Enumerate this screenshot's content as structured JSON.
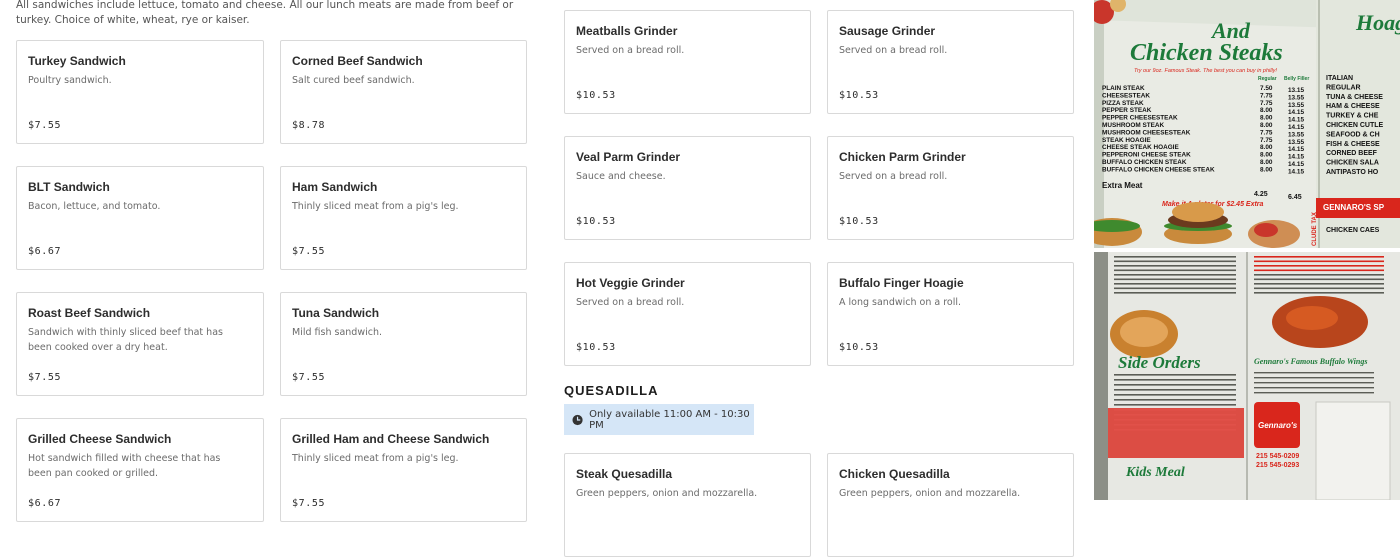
{
  "sandwiches": {
    "intro": "All sandwiches include lettuce, tomato and cheese. All our lunch meats are made from beef or turkey. Choice of white, wheat, rye or kaiser.",
    "items": [
      {
        "name": "Turkey Sandwich",
        "desc": "Poultry sandwich.",
        "price": "$7.55"
      },
      {
        "name": "Corned Beef Sandwich",
        "desc": "Salt cured beef sandwich.",
        "price": "$8.78"
      },
      {
        "name": "BLT Sandwich",
        "desc": "Bacon, lettuce, and tomato.",
        "price": "$6.67"
      },
      {
        "name": "Ham Sandwich",
        "desc": "Thinly sliced meat from a pig's leg.",
        "price": "$7.55"
      },
      {
        "name": "Roast Beef Sandwich",
        "desc": "Sandwich with thinly sliced beef that has been cooked over a dry heat.",
        "price": "$7.55"
      },
      {
        "name": "Tuna Sandwich",
        "desc": "Mild fish sandwich.",
        "price": "$7.55"
      },
      {
        "name": "Grilled Cheese Sandwich",
        "desc": "Hot sandwich filled with cheese that has been pan cooked or grilled.",
        "price": "$6.67"
      },
      {
        "name": "Grilled Ham and Cheese Sandwich",
        "desc": "Thinly sliced meat from a pig's leg.",
        "price": "$7.55"
      }
    ]
  },
  "grinders": {
    "items": [
      {
        "name": "Meatballs Grinder",
        "desc": "Served on a bread roll.",
        "price": "$10.53"
      },
      {
        "name": "Sausage Grinder",
        "desc": "Served on a bread roll.",
        "price": "$10.53"
      },
      {
        "name": "Veal Parm Grinder",
        "desc": "Sauce and cheese.",
        "price": "$10.53"
      },
      {
        "name": "Chicken Parm Grinder",
        "desc": "Served on a bread roll.",
        "price": "$10.53"
      },
      {
        "name": "Hot Veggie Grinder",
        "desc": "Served on a bread roll.",
        "price": "$10.53"
      },
      {
        "name": "Buffalo Finger Hoagie",
        "desc": "A long sandwich on a roll.",
        "price": "$10.53"
      }
    ]
  },
  "quesadilla": {
    "title": "QUESADILLA",
    "availability": "Only available 11:00 AM - 10:30 PM",
    "items": [
      {
        "name": "Steak Quesadilla",
        "desc": "Green peppers, onion and mozzarella."
      },
      {
        "name": "Chicken Quesadilla",
        "desc": "Green peppers, onion and mozzarella."
      }
    ]
  },
  "menu_photos": {
    "top": {
      "headline_1": "Hoag",
      "headline_2": "And",
      "headline_3": "Chicken Steaks",
      "slogan": "Try our 9oz. Famous Steak. The best you can buy in philly!",
      "col_regular": "Regular",
      "col_belly": "Belly Filler",
      "rows": [
        {
          "name": "PLAIN STEAK",
          "reg": "7.50",
          "big": "13.15"
        },
        {
          "name": "CHEESESTEAK",
          "reg": "7.75",
          "big": "13.55"
        },
        {
          "name": "PIZZA STEAK",
          "reg": "7.75",
          "big": "13.55"
        },
        {
          "name": "PEPPER STEAK",
          "reg": "8.00",
          "big": "14.15"
        },
        {
          "name": "PEPPER CHEESESTEAK",
          "reg": "8.00",
          "big": "14.15"
        },
        {
          "name": "MUSHROOM STEAK",
          "reg": "8.00",
          "big": "14.15"
        },
        {
          "name": "MUSHROOM CHEESESTEAK",
          "reg": "7.75",
          "big": "13.55"
        },
        {
          "name": "STEAK HOAGIE",
          "reg": "7.75",
          "big": "13.55"
        },
        {
          "name": "CHEESE STEAK HOAGIE",
          "reg": "8.00",
          "big": "14.15"
        },
        {
          "name": "PEPPERONI CHEESE STEAK",
          "reg": "8.00",
          "big": "14.15"
        },
        {
          "name": "BUFFALO CHICKEN STEAK",
          "reg": "8.00",
          "big": "14.15"
        },
        {
          "name": "BUFFALO CHICKEN CHEESE STEAK",
          "reg": "8.00",
          "big": "14.15"
        }
      ],
      "extra_meat": "Extra Meat",
      "extra_meat_reg": "4.25",
      "extra_meat_big": "6.45",
      "platter_banner": "Make it A plater for $2.45 Extra",
      "right_items": [
        "ITALIAN",
        "REGULAR",
        "TUNA & CHEESE",
        "HAM & CHEESE",
        "TURKEY & CHE",
        "CHICKEN CUTLE",
        "SEAFOOD & CH",
        "FISH & CHEESE",
        "CORNED BEEF",
        "CHICKEN SALA",
        "ANTIPASTO HO",
        "CHICKEN CAES"
      ],
      "specials": "GENNARO'S SP",
      "side_tax": "CLUDE TAX"
    },
    "bottom": {
      "side_orders": "Side Orders",
      "wings_title": "Gennaro's Famous Buffalo Wings",
      "kids_meal": "Kids Meal",
      "logo": "Gennaro's",
      "phone_1": "215 545-0209",
      "phone_2": "215 545-0293"
    }
  },
  "colors": {
    "card_border": "#d9d9d9",
    "availability_bg": "#d5e6f7",
    "menu_red": "#d9261c",
    "menu_green": "#1d7a3a"
  }
}
